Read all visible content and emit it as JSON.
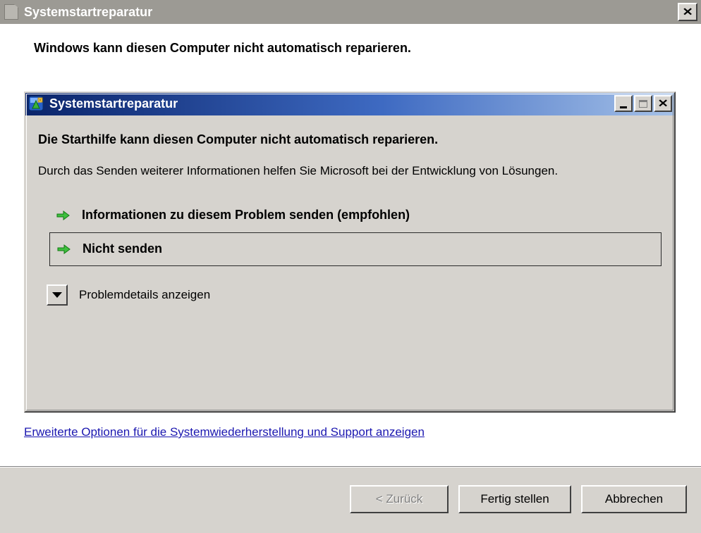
{
  "outer": {
    "title": "Systemstartreparatur",
    "heading": "Windows kann diesen Computer nicht automatisch reparieren."
  },
  "inner": {
    "title": "Systemstartreparatur",
    "heading": "Die Starthilfe kann diesen Computer nicht automatisch reparieren.",
    "description": "Durch das Senden weiterer Informationen helfen Sie Microsoft bei der Entwicklung von Lösungen.",
    "options": [
      {
        "label": "Informationen zu diesem Problem senden (empfohlen)",
        "selected": false
      },
      {
        "label": "Nicht senden",
        "selected": true
      }
    ],
    "details_label": "Problemdetails anzeigen"
  },
  "link": "Erweiterte Optionen für die Systemwiederherstellung und Support anzeigen",
  "buttons": {
    "back": "< Zurück",
    "finish": "Fertig stellen",
    "cancel": "Abbrechen"
  }
}
